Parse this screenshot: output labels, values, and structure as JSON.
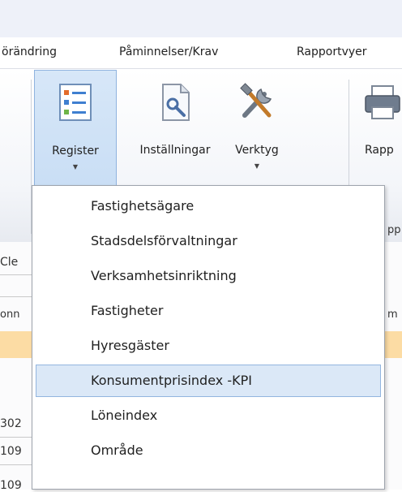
{
  "tabs": [
    {
      "label": "örändring"
    },
    {
      "label": "Påminnelser/Krav"
    },
    {
      "label": "Rapportvyer"
    }
  ],
  "ribbon": {
    "buttons": [
      {
        "label": "Register",
        "icon": "register-list-icon",
        "has_dropdown": true,
        "active": true
      },
      {
        "label": "Inställningar",
        "icon": "settings-document-icon",
        "has_dropdown": false
      },
      {
        "label": "Verktyg",
        "icon": "tools-icon",
        "has_dropdown": true
      },
      {
        "label": "Rapp",
        "icon": "printer-icon",
        "has_dropdown": false
      }
    ],
    "group_label_fragment": "pp",
    "caret": "▼"
  },
  "background_fragments": {
    "cle": "Cle",
    "col1": "onn",
    "col2": "m",
    "rows": [
      "302",
      "109",
      "109"
    ]
  },
  "menu": {
    "items": [
      {
        "label": "Fastighetsägare"
      },
      {
        "label": "Stadsdelsförvaltningar"
      },
      {
        "label": "Verksamhetsinriktning"
      },
      {
        "label": "Fastigheter"
      },
      {
        "label": "Hyresgäster"
      },
      {
        "label": "Konsumentprisindex -KPI",
        "selected": true
      },
      {
        "label": "Löneindex"
      },
      {
        "label": "Område"
      }
    ]
  },
  "colors": {
    "active_button_bg": "#c6dcf4",
    "selected_item_bg": "#dbe8f7",
    "row_highlight": "#fcdca4"
  }
}
